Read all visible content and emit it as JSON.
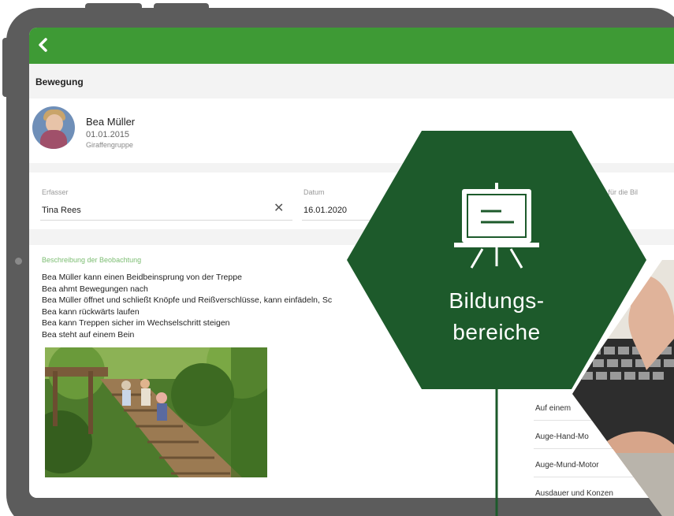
{
  "app": {
    "section_title": "Bewegung"
  },
  "profile": {
    "name": "Bea Müller",
    "birthdate": "01.01.2015",
    "group": "Giraffengruppe"
  },
  "form": {
    "recorder_label": "Erfasser",
    "recorder_value": "Tina Rees",
    "date_label": "Datum",
    "date_value": "16.01.2020",
    "partial_label": "ed für die Bil"
  },
  "observation": {
    "label": "Beschreibung der Beobachtung",
    "lines": [
      "Bea Müller kann einen Beidbeinsprung von der Treppe",
      "Bea ahmt Bewegungen nach",
      "Bea Müller öffnet und schließt Knöpfe und Reißverschlüsse, kann einfädeln, Sc",
      "Bea kann rückwärts laufen",
      "Bea kann Treppen sicher im Wechselschritt steigen",
      "Bea steht auf einem Bein"
    ]
  },
  "areas_list": [
    "Auf einem",
    "Auge-Hand-Mo",
    "Auge-Mund-Motor",
    "Ausdauer und Konzen"
  ],
  "badge": {
    "line1": "Bildungs-",
    "line2": "bereiche",
    "icon": "presentation-board-icon"
  },
  "colors": {
    "appbar": "#3e9a35",
    "hexagon": "#1d5a2b",
    "frame": "#5c5c5c"
  }
}
